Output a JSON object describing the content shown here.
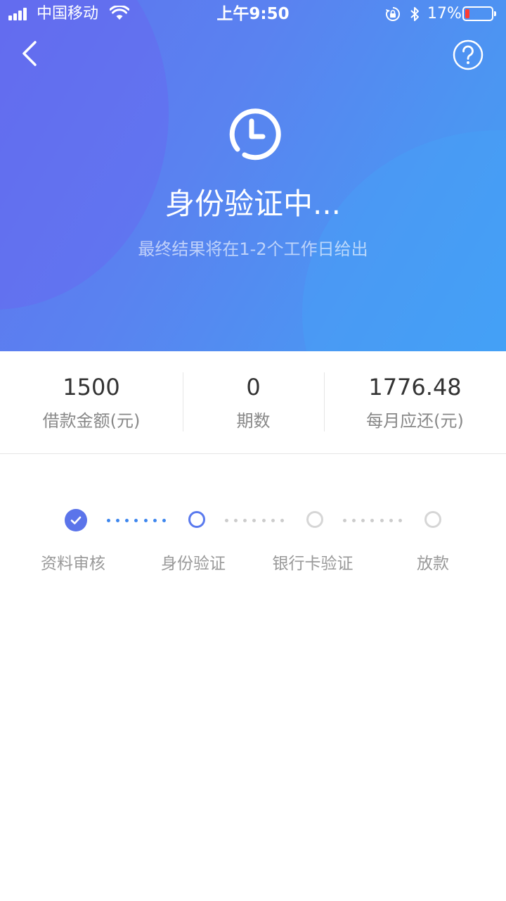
{
  "status_bar": {
    "carrier": "中国移动",
    "time": "上午9:50",
    "battery_percent": "17%",
    "battery_level": 0.17,
    "icons": [
      "signal-icon",
      "wifi-icon",
      "rotation-lock-icon",
      "bluetooth-icon",
      "battery-icon"
    ]
  },
  "nav": {
    "back_icon": "chevron-left-icon",
    "help_icon": "question-circle-icon"
  },
  "status": {
    "icon": "clock-icon",
    "title": "身份验证中...",
    "subtitle": "最终结果将在1-2个工作日给出"
  },
  "summary": {
    "items": [
      {
        "value": "1500",
        "label": "借款金额(元)"
      },
      {
        "value": "0",
        "label": "期数"
      },
      {
        "value": "1776.48",
        "label": "每月应还(元)"
      }
    ]
  },
  "steps": {
    "items": [
      {
        "label": "资料审核",
        "state": "done"
      },
      {
        "label": "身份验证",
        "state": "current"
      },
      {
        "label": "银行卡验证",
        "state": "pending"
      },
      {
        "label": "放款",
        "state": "pending"
      }
    ]
  },
  "colors": {
    "gradient_start": "#5f73ee",
    "gradient_end": "#439ef4",
    "accent": "#5a7aee",
    "progress_dot": "#3d86ee",
    "inactive": "#d6d6d6",
    "battery_low": "#ff3b30"
  }
}
